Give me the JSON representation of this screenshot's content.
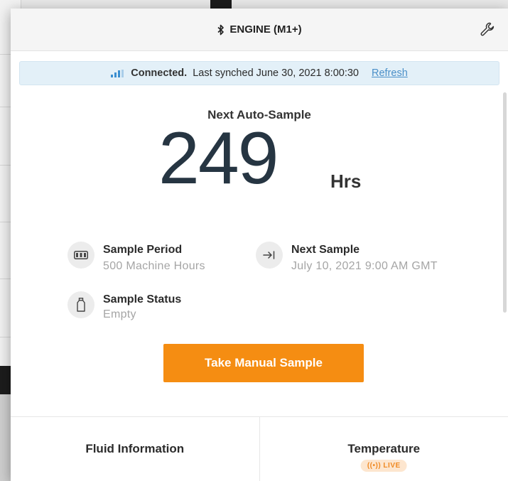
{
  "header": {
    "title": "ENGINE (M1+)",
    "bluetooth_icon": "bluetooth-icon",
    "settings_icon": "wrench-icon"
  },
  "status": {
    "signal_icon": "signal-bars-icon",
    "connected": "Connected.",
    "last_synched": "Last synched June 30, 2021 8:00:30",
    "refresh": "Refresh",
    "accent": "#3b8fd0"
  },
  "auto_sample": {
    "title": "Next Auto-Sample",
    "value": "249",
    "unit": "Hrs"
  },
  "info": {
    "sample_period": {
      "icon": "battery-icon",
      "label": "Sample Period",
      "value": "500 Machine Hours"
    },
    "next_sample": {
      "icon": "arrow-to-line-icon",
      "label": "Next Sample",
      "value": "July 10, 2021 9:00 AM GMT"
    },
    "sample_status": {
      "icon": "bottle-icon",
      "label": "Sample Status",
      "value": "Empty"
    }
  },
  "action": {
    "manual_sample": "Take Manual Sample",
    "color": "#f58d12"
  },
  "bottom": {
    "fluid_title": "Fluid Information",
    "temperature_title": "Temperature",
    "live_badge": "((•)) LIVE"
  }
}
